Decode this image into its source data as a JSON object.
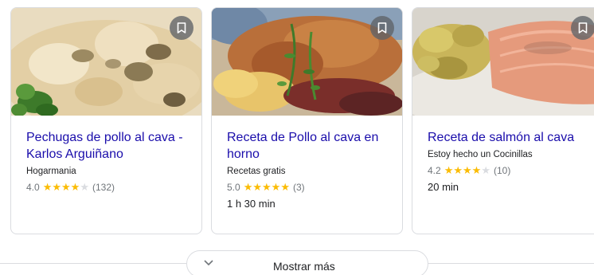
{
  "recipes": [
    {
      "title": "Pechugas de pollo al cava - Karlos Arguiñano",
      "source": "Hogarmania",
      "rating": "4.0",
      "stars": 4,
      "reviews": "(132)",
      "time": ""
    },
    {
      "title": "Receta de Pollo al cava en horno",
      "source": "Recetas gratis",
      "rating": "5.0",
      "stars": 5,
      "reviews": "(3)",
      "time": "1 h 30 min"
    },
    {
      "title": "Receta de salmón al cava",
      "source": "Estoy hecho un Cocinillas",
      "rating": "4.2",
      "stars": 4,
      "reviews": "(10)",
      "time": "20 min"
    }
  ],
  "show_more": {
    "label": "Mostrar más"
  },
  "icons": {
    "save": "bookmark-icon",
    "expand": "chevron-down-icon",
    "star": "star-icon"
  },
  "colors": {
    "title_link": "#1a0dab",
    "star_filled": "#fbbc04",
    "star_empty": "#dadce0",
    "border": "#dadce0"
  }
}
